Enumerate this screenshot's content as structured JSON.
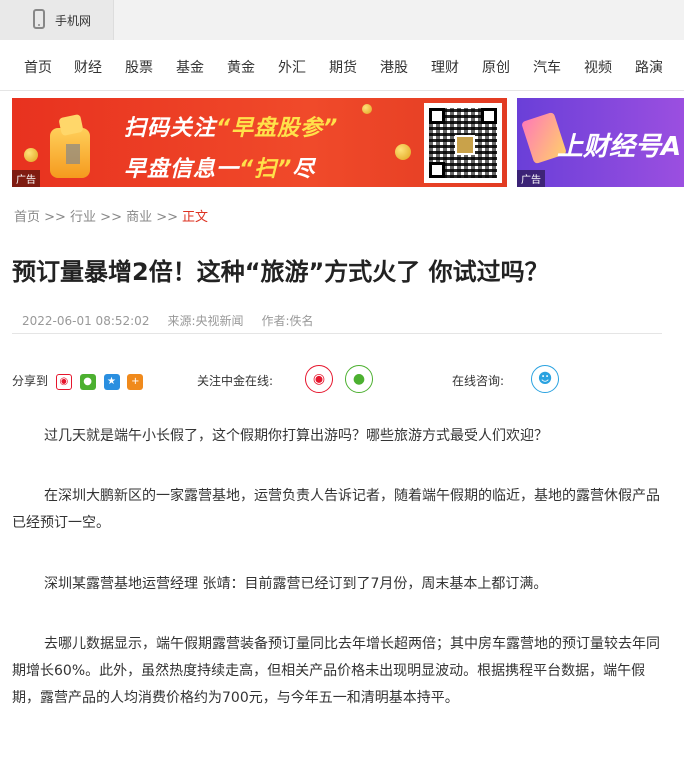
{
  "topbar": {
    "mobile_label": "手机网"
  },
  "nav": [
    "首页",
    "财经",
    "股票",
    "基金",
    "黄金",
    "外汇",
    "期货",
    "港股",
    "理财",
    "原创",
    "汽车",
    "视频",
    "路演"
  ],
  "banner_main": {
    "ad_label": "广告",
    "line1_a": "扫码关注",
    "line1_b": "“早盘股参”",
    "line2_a": "早盘信息一",
    "line2_b": "“扫”",
    "line2_c": "尽"
  },
  "banner_side": {
    "ad_label": "广告",
    "text": "上财经号A"
  },
  "breadcrumb": {
    "path": "首页 >> 行业 >> 商业 >>",
    "current": "正文"
  },
  "article": {
    "title": "预订量暴增2倍！这种“旅游”方式火了 你试过吗？",
    "datetime": "2022-06-01 08:52:02",
    "source": "来源:央视新闻",
    "author": "作者:佚名"
  },
  "share": {
    "label": "分享到"
  },
  "follow": {
    "label": "关注中金在线:"
  },
  "consult": {
    "label": "在线咨询:"
  },
  "paragraphs": [
    "过几天就是端午小长假了，这个假期你打算出游吗？哪些旅游方式最受人们欢迎？",
    "在深圳大鹏新区的一家露营基地，运营负责人告诉记者，随着端午假期的临近，基地的露营休假产品已经预订一空。",
    "深圳某露营基地运营经理 张靖：目前露营已经订到了7月份，周末基本上都订满。",
    "去哪儿数据显示，端午假期露营装备预订量同比去年增长超两倍；其中房车露营地的预订量较去年同期增长60%。此外，虽然热度持续走高，但相关产品价格未出现明显波动。根据携程平台数据，端午假期，露营产品的人均消费价格约为700元，与今年五一和清明基本持平。"
  ],
  "colors": {
    "accent_red": "#d32",
    "banner_red": "#e8321f",
    "banner_purple": "#7b46dc",
    "weibo": "#e6162d",
    "wechat": "#4cb030",
    "qq": "#2aa2e0"
  }
}
